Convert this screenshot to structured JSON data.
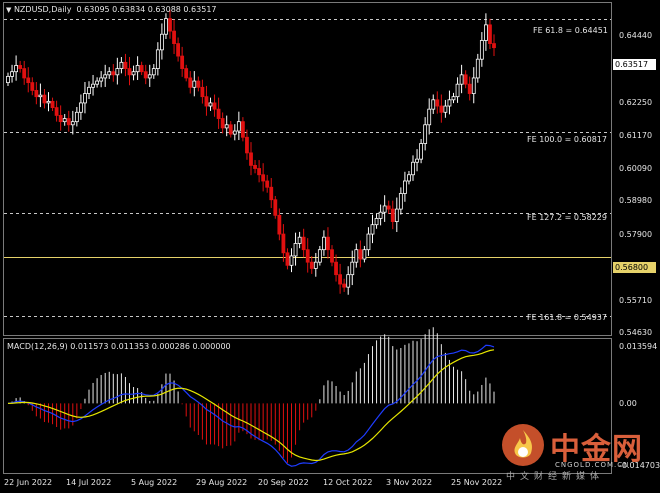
{
  "header": {
    "symbol": "NZDUSD,Daily",
    "ohlc": "0.63095 0.63834 0.63088 0.63517"
  },
  "macd_header": {
    "label": "MACD(12,26,9) 0.011573 0.011353 0.000286 0.000000"
  },
  "fib_levels": [
    {
      "label": "FE 61.8 = 0.64451",
      "value": 0.64451
    },
    {
      "label": "FE 100.0 = 0.60817",
      "value": 0.60817
    },
    {
      "label": "FE 127.2 = 0.58229",
      "value": 0.58229
    },
    {
      "label": "FE 161.8 = 0.54937",
      "value": 0.54937
    }
  ],
  "horizontal_line": {
    "label": "0.56800",
    "value": 0.568,
    "color": "#e6d26a"
  },
  "current_price": {
    "label": "0.63517",
    "value": 0.63517
  },
  "price_axis": [
    "0.64440",
    "0.63517",
    "0.62250",
    "0.61170",
    "0.60090",
    "0.58980",
    "0.57900",
    "0.56800",
    "0.55710",
    "0.54630"
  ],
  "macd_axis": [
    "0.013594",
    "0.00",
    "-0.014703"
  ],
  "time_axis": [
    "22 Jun 2022",
    "14 Jul 2022",
    "5 Aug 2022",
    "29 Aug 2022",
    "20 Sep 2022",
    "12 Oct 2022",
    "3 Nov 2022",
    "25 Nov 2022"
  ],
  "colors": {
    "bull": "#ffffff",
    "bear": "#e01010",
    "signal": "#e6e600",
    "macd_line": "#1e3cff",
    "histogram": "#e8e8e8",
    "grid_dash": "#c8c8c8"
  },
  "watermark": {
    "cn": "中金网",
    "en": "CNGOLD.COM.CN",
    "sub": "中文财经新媒体",
    "icon": "flame-logo-icon"
  },
  "chart_data": {
    "type": "candlestick",
    "title": "NZDUSD,Daily",
    "ylim": [
      0.5435,
      0.6495
    ],
    "closes": [
      0.626,
      0.6275,
      0.6295,
      0.6285,
      0.6255,
      0.624,
      0.6215,
      0.6195,
      0.62,
      0.6175,
      0.618,
      0.616,
      0.6135,
      0.6115,
      0.6125,
      0.6105,
      0.6115,
      0.6145,
      0.6175,
      0.6205,
      0.6225,
      0.6235,
      0.6245,
      0.6255,
      0.6265,
      0.6275,
      0.6265,
      0.6285,
      0.6305,
      0.6285,
      0.6265,
      0.6275,
      0.6295,
      0.6275,
      0.6255,
      0.6265,
      0.6285,
      0.6345,
      0.6395,
      0.6445,
      0.6405,
      0.6365,
      0.6325,
      0.6285,
      0.6255,
      0.6225,
      0.6245,
      0.6225,
      0.6195,
      0.6165,
      0.6175,
      0.6155,
      0.6125,
      0.6095,
      0.6105,
      0.6075,
      0.6085,
      0.6115,
      0.6065,
      0.6015,
      0.5975,
      0.5965,
      0.5945,
      0.5925,
      0.5905,
      0.5865,
      0.5815,
      0.5755,
      0.5695,
      0.5655,
      0.5685,
      0.5725,
      0.5745,
      0.5705,
      0.5665,
      0.5645,
      0.5665,
      0.5705,
      0.5745,
      0.5705,
      0.5665,
      0.5625,
      0.5595,
      0.5585,
      0.5625,
      0.5665,
      0.5705,
      0.5675,
      0.5705,
      0.5755,
      0.5785,
      0.5805,
      0.5825,
      0.5845,
      0.5835,
      0.5795,
      0.5835,
      0.5885,
      0.5925,
      0.5945,
      0.5985,
      0.5995,
      0.6045,
      0.6105,
      0.6155,
      0.6185,
      0.6165,
      0.6145,
      0.6165,
      0.6185,
      0.6195,
      0.6235,
      0.6265,
      0.6235,
      0.6205,
      0.6255,
      0.6315,
      0.6375,
      0.6425,
      0.6365,
      0.6352
    ],
    "date_labels": [
      "22 Jun 2022",
      "14 Jul 2022",
      "5 Aug 2022",
      "29 Aug 2022",
      "20 Sep 2022",
      "12 Oct 2022",
      "3 Nov 2022",
      "25 Nov 2022"
    ],
    "macd": {
      "params": "12,26,9",
      "values": [
        0.011573,
        0.011353,
        0.000286,
        0.0
      ],
      "ylim": [
        -0.014703,
        0.013594
      ]
    }
  }
}
